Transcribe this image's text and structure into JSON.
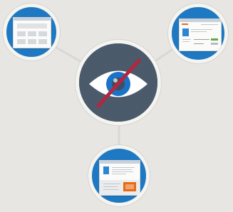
{
  "colors": {
    "background": "#e7e6e2",
    "node_blue": "#1f78c2",
    "center_dark": "#485869",
    "ring": "#f4f4f1",
    "eye_white": "#ffffff",
    "iris": "#1a73c4",
    "pupil": "#3e4f61",
    "slash": "#b3273f",
    "connector": "#d9d8d4"
  },
  "icons": {
    "center": "eye-slash-icon",
    "top_left": "webpage-grid-screen",
    "top_right": "webpage-form-screen",
    "bottom": "webpage-article-screen"
  }
}
